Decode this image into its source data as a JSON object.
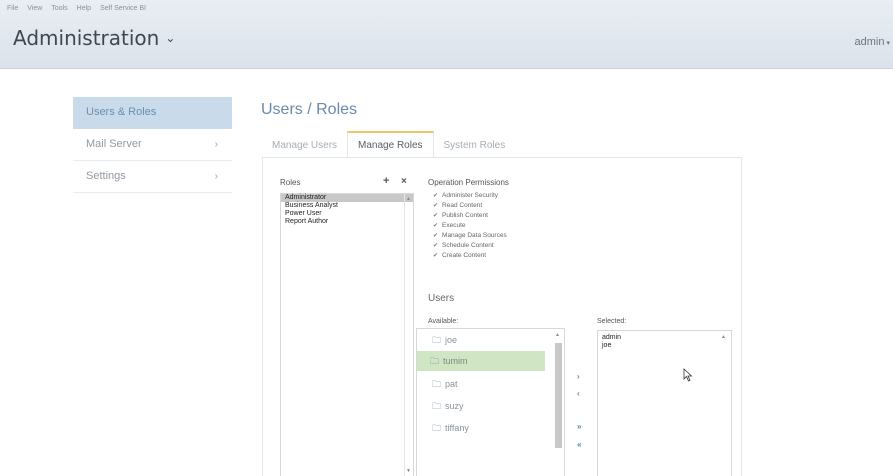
{
  "menubar": [
    "File",
    "View",
    "Tools",
    "Help",
    "Self Service BI"
  ],
  "header": {
    "title": "Administration",
    "user": "admin"
  },
  "sidebar": {
    "items": [
      {
        "label": "Users & Roles"
      },
      {
        "label": "Mail Server"
      },
      {
        "label": "Settings"
      }
    ]
  },
  "main": {
    "title": "Users / Roles",
    "tabs": [
      {
        "label": "Manage Users"
      },
      {
        "label": "Manage Roles"
      },
      {
        "label": "System Roles"
      }
    ]
  },
  "roles": {
    "label": "Roles",
    "add": "+",
    "remove": "×",
    "items": [
      "Administrator",
      "Business Analyst",
      "Power User",
      "Report Author"
    ],
    "selected_index": 0
  },
  "permissions": {
    "label": "Operation Permissions",
    "items": [
      "Administer Security",
      "Read Content",
      "Publish Content",
      "Execute",
      "Manage Data Sources",
      "Schedule Content",
      "Create Content"
    ]
  },
  "users": {
    "label": "Users",
    "available_label": "Available:",
    "selected_label": "Selected:",
    "available": [
      "joe",
      "tumim",
      "pat",
      "suzy",
      "tiffany"
    ],
    "highlighted_index": 1,
    "selected": [
      "admin",
      "joe"
    ],
    "move_buttons": [
      "›",
      "‹",
      "»",
      "«"
    ]
  },
  "colors": {
    "header_bg": "#dfe6ed",
    "sidebar_active": "#c9dbea",
    "tab_accent": "#e6c86e",
    "highlight_row": "#cfe5c4",
    "title_blue": "#6a8aab"
  },
  "icons": {
    "folder": "folder-icon",
    "cursor": "mouse-pointer-icon"
  }
}
